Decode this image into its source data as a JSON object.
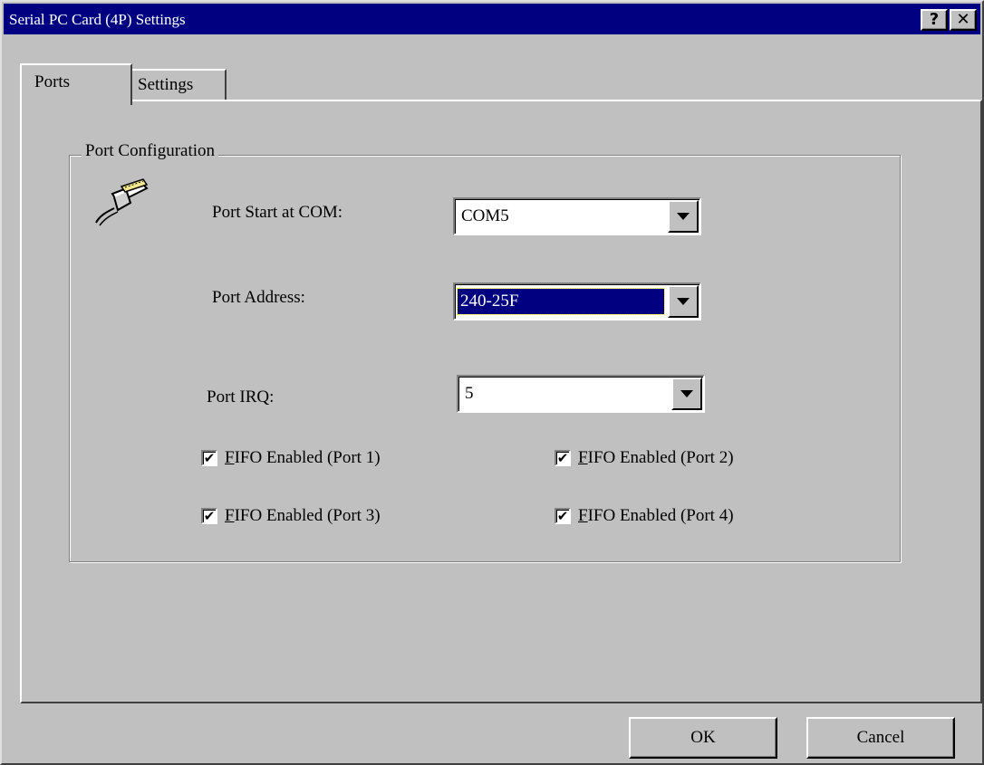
{
  "window": {
    "title": "Serial PC Card (4P) Settings",
    "help_glyph": "?",
    "close_glyph": "✕"
  },
  "tabs": [
    {
      "label": "Ports",
      "selected": true
    },
    {
      "label": "Settings",
      "selected": false
    }
  ],
  "group": {
    "title": "Port Configuration",
    "icon": "serial-port-icon"
  },
  "fields": {
    "port_start": {
      "label": "Port Start at COM:",
      "value": "COM5"
    },
    "port_address": {
      "label": "Port Address:",
      "value": "240-25F"
    },
    "port_irq": {
      "label": "Port IRQ:",
      "value": "5"
    }
  },
  "checkboxes": [
    {
      "accel": "F",
      "rest": "IFO Enabled (Port 1)",
      "checked": true
    },
    {
      "accel": "F",
      "rest": "IFO Enabled (Port 2)",
      "checked": true
    },
    {
      "accel": "F",
      "rest": "IFO Enabled (Port 3)",
      "checked": true
    },
    {
      "accel": "F",
      "rest": "IFO Enabled (Port 4)",
      "checked": true
    }
  ],
  "check_glyph": "✔",
  "buttons": {
    "ok": "OK",
    "cancel": "Cancel"
  },
  "colors": {
    "titlebar": "#000080",
    "face": "#c0c0c0",
    "selection": "#000080"
  }
}
